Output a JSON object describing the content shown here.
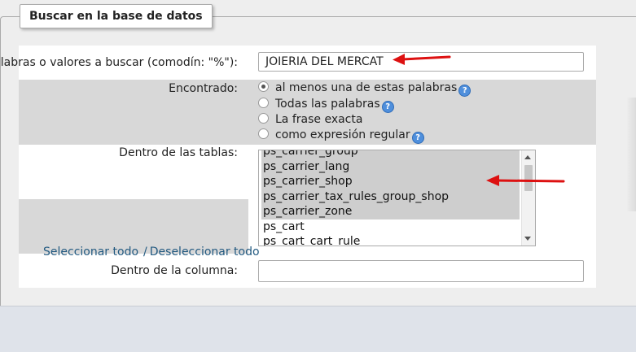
{
  "legend": "Buscar en la base de datos",
  "search": {
    "label": "Palabras o valores a buscar (comodín: \"%\"):",
    "value": "JOIERIA DEL MERCAT"
  },
  "found": {
    "label": "Encontrado:",
    "options": [
      {
        "label": "al menos una de estas palabras",
        "checked": true,
        "help": true
      },
      {
        "label": "Todas las palabras",
        "checked": false,
        "help": true
      },
      {
        "label": "La frase exacta",
        "checked": false,
        "help": false
      },
      {
        "label": "como expresión regular",
        "checked": false,
        "help": true
      }
    ]
  },
  "tables": {
    "label": "Dentro de las tablas:",
    "items": [
      {
        "name": "ps_carrier_group",
        "selected": true
      },
      {
        "name": "ps_carrier_lang",
        "selected": true
      },
      {
        "name": "ps_carrier_shop",
        "selected": true
      },
      {
        "name": "ps_carrier_tax_rules_group_shop",
        "selected": true
      },
      {
        "name": "ps_carrier_zone",
        "selected": true
      },
      {
        "name": "ps_cart",
        "selected": false
      },
      {
        "name": "ps_cart_cart_rule",
        "selected": false
      }
    ],
    "select_all": "Seleccionar todo",
    "separator": "/",
    "deselect_all": "Deseleccionar todo"
  },
  "column": {
    "label": "Dentro de la columna:",
    "value": ""
  },
  "colors": {
    "annotation_arrow": "#dd1111",
    "link": "#235a81",
    "selected_row": "#cecece"
  }
}
